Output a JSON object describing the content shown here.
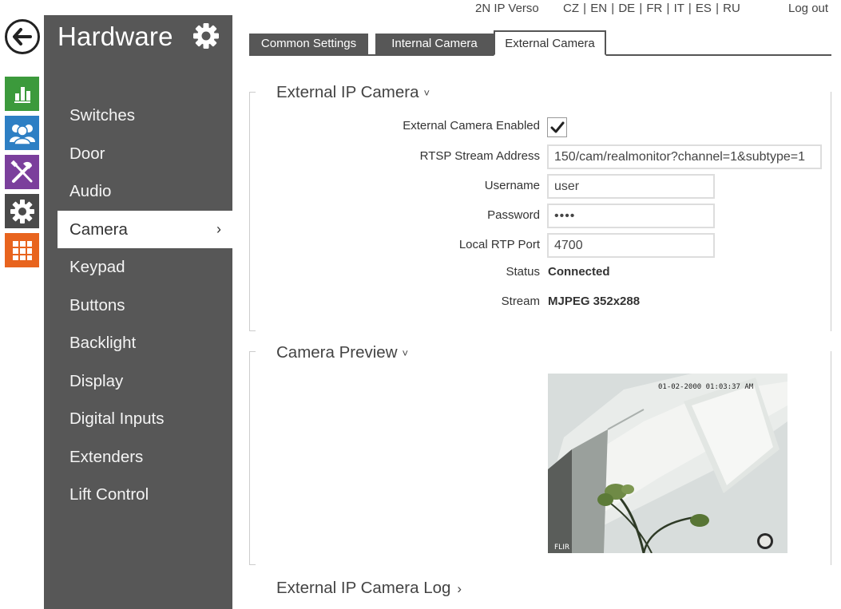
{
  "topbar": {
    "product": "2N IP Verso",
    "languages": [
      "CZ",
      "EN",
      "DE",
      "FR",
      "IT",
      "ES",
      "RU"
    ],
    "logout": "Log out"
  },
  "rail": {
    "icons": [
      "back-arrow-icon",
      "status-chart-icon",
      "directory-users-icon",
      "hardware-tools-icon",
      "system-gear-icon",
      "services-grid-icon"
    ]
  },
  "sidebar": {
    "title": "Hardware",
    "items": [
      {
        "label": "Switches"
      },
      {
        "label": "Door"
      },
      {
        "label": "Audio"
      },
      {
        "label": "Camera",
        "active": true
      },
      {
        "label": "Keypad"
      },
      {
        "label": "Buttons"
      },
      {
        "label": "Backlight"
      },
      {
        "label": "Display"
      },
      {
        "label": "Digital Inputs"
      },
      {
        "label": "Extenders"
      },
      {
        "label": "Lift Control"
      }
    ],
    "active_chevron": "›"
  },
  "tabs": [
    {
      "label": "Common Settings"
    },
    {
      "label": "Internal Camera"
    },
    {
      "label": "External Camera",
      "active": true
    }
  ],
  "external_camera": {
    "title": "External IP Camera",
    "chevron": "˅",
    "enabled_label": "External Camera Enabled",
    "enabled": true,
    "rtsp_label": "RTSP Stream Address",
    "rtsp_value": "150/cam/realmonitor?channel=1&subtype=1",
    "username_label": "Username",
    "username_value": "user",
    "password_label": "Password",
    "password_value": "••••",
    "rtp_port_label": "Local RTP Port",
    "rtp_port_value": "4700",
    "status_label": "Status",
    "status_value": "Connected",
    "stream_label": "Stream",
    "stream_value": "MJPEG 352x288"
  },
  "preview": {
    "title": "Camera Preview",
    "chevron": "˅",
    "timestamp": "01-02-2000 01:03:37 AM",
    "watermark": "FLIR"
  },
  "log": {
    "title": "External IP Camera Log",
    "chevron": "›"
  },
  "colors": {
    "sidebar_bg": "#575757",
    "status_green": "#3c9a3c",
    "directory_blue": "#2d7fc4",
    "hardware_purple": "#7b3f9c",
    "system_dark": "#4a4a4a",
    "services_orange": "#e8641e"
  }
}
